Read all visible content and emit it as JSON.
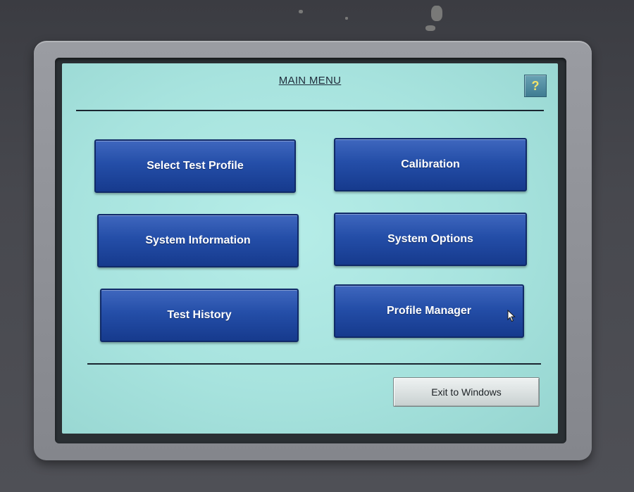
{
  "screen": {
    "title": "MAIN MENU",
    "help_label": "?"
  },
  "menu": {
    "items": [
      {
        "label": "Select Test Profile"
      },
      {
        "label": "Calibration"
      },
      {
        "label": "System Information"
      },
      {
        "label": "System Options"
      },
      {
        "label": "Test History"
      },
      {
        "label": "Profile Manager"
      }
    ]
  },
  "footer": {
    "exit_label": "Exit to Windows"
  },
  "colors": {
    "screen_background": "#a7e3de",
    "button_blue": "#244ea8",
    "help_question_mark": "#f3e36a"
  },
  "icons": {
    "help": "question-mark-icon",
    "pointer": "mouse-pointer-icon"
  }
}
